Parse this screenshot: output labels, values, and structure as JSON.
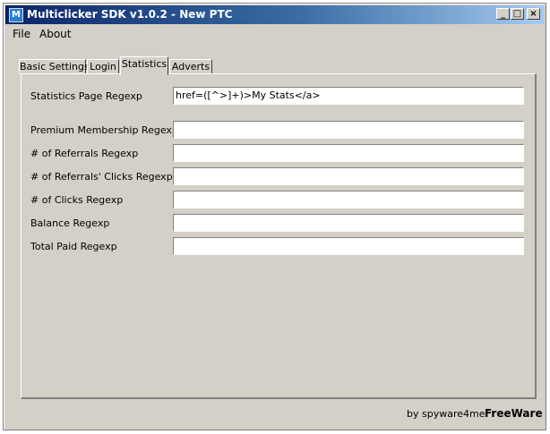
{
  "window": {
    "title": "Multiclicker SDK v1.0.2 - New PTC",
    "app_icon_letter": "M",
    "buttons": {
      "minimize": "_",
      "maximize": "□",
      "close": "×"
    }
  },
  "menu": {
    "items": [
      {
        "label": "File"
      },
      {
        "label": "About"
      }
    ]
  },
  "tabs": [
    {
      "label": "Basic Settings",
      "active": false
    },
    {
      "label": "Login",
      "active": false
    },
    {
      "label": "Statistics",
      "active": true
    },
    {
      "label": "Adverts",
      "active": false
    }
  ],
  "fields": [
    {
      "label": "Statistics Page Regexp",
      "value": "href=([^>]+)>My Stats</a>"
    },
    {
      "label": "Premium Membership Regexp",
      "value": ""
    },
    {
      "label": "# of Referrals Regexp",
      "value": ""
    },
    {
      "label": "# of Referrals' Clicks Regexp",
      "value": ""
    },
    {
      "label": "# of Clicks Regexp",
      "value": ""
    },
    {
      "label": "Balance Regexp",
      "value": ""
    },
    {
      "label": "Total Paid Regexp",
      "value": ""
    }
  ],
  "footer": {
    "credit": "by spyware4me",
    "license": "FreeWare"
  }
}
